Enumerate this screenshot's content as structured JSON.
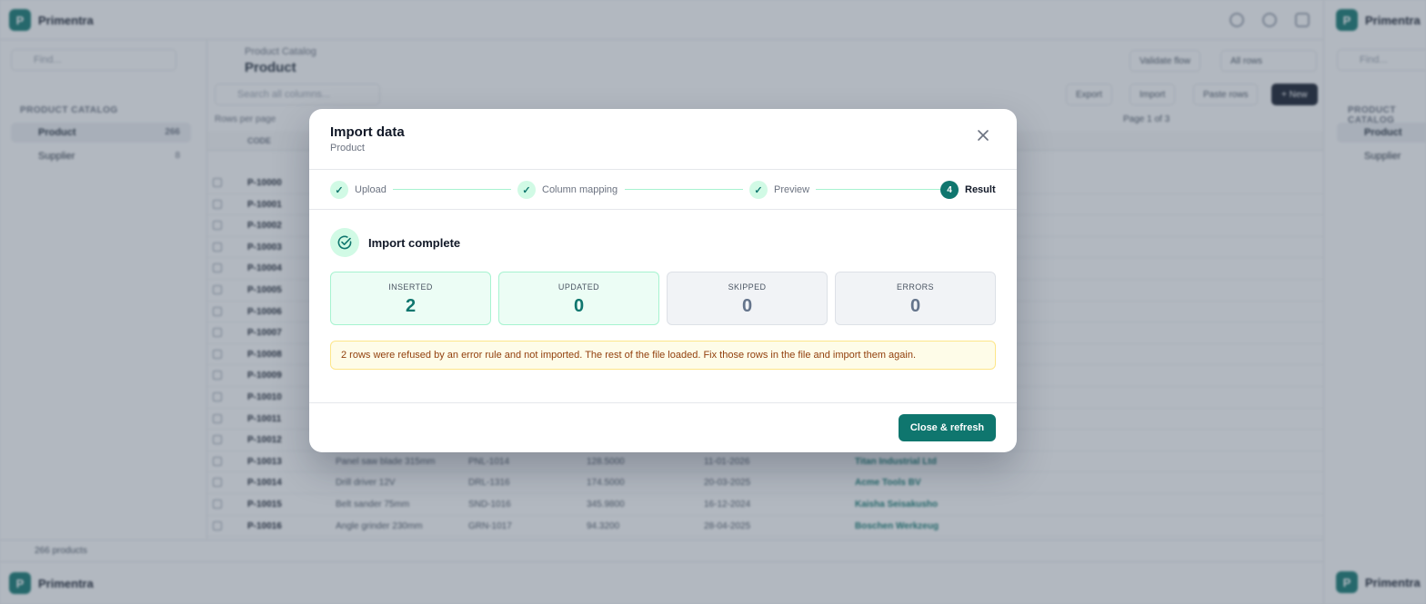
{
  "app": {
    "brand": "Primentra",
    "logo_letter": "P",
    "find_placeholder": "Find...",
    "sidebar": {
      "group": "PRODUCT CATALOG",
      "items": [
        {
          "label": "Product",
          "count": "266"
        },
        {
          "label": "Supplier",
          "count": "8"
        }
      ]
    },
    "header": {
      "breadcrumb": "Product Catalog",
      "title": "Product",
      "validate_label": "Validate flow",
      "view_label": "All rows"
    },
    "toolbar": {
      "search_placeholder": "Search all columns...",
      "export_label": "Export",
      "import_label": "Import",
      "paste_label": "Paste rows",
      "new_label": "+ New"
    },
    "grid": {
      "rows_per_page": "Rows per page",
      "page_info": "Page 1 of 3",
      "header_code": "CODE",
      "rows": [
        {
          "code": "P-10000"
        },
        {
          "code": "P-10001"
        },
        {
          "code": "P-10002"
        },
        {
          "code": "P-10003"
        },
        {
          "code": "P-10004"
        },
        {
          "code": "P-10005"
        },
        {
          "code": "P-10006"
        },
        {
          "code": "P-10007"
        },
        {
          "code": "P-10008"
        },
        {
          "code": "P-10009"
        },
        {
          "code": "P-10010"
        },
        {
          "code": "P-10011"
        },
        {
          "code": "P-10012"
        },
        {
          "code": "P-10013",
          "name": "Panel saw blade 315mm",
          "sku": "PNL-1014",
          "price": "128.5000",
          "date": "11-01-2026",
          "supplier": "Titan Industrial Ltd"
        },
        {
          "code": "P-10014",
          "name": "Drill driver 12V",
          "sku": "DRL-1316",
          "price": "174.5000",
          "date": "20-03-2025",
          "supplier": "Acme Tools BV"
        },
        {
          "code": "P-10015",
          "name": "Belt sander 75mm",
          "sku": "SND-1016",
          "price": "345.9800",
          "date": "16-12-2024",
          "supplier": "Kaisha Seisakusho"
        },
        {
          "code": "P-10016",
          "name": "Angle grinder 230mm",
          "sku": "GRN-1017",
          "price": "94.3200",
          "date": "28-04-2025",
          "supplier": "Boschen Werkzeug"
        }
      ]
    },
    "footer": {
      "count": "266 products"
    }
  },
  "modal": {
    "title": "Import data",
    "subtitle": "Product",
    "close_icon": "close-icon",
    "steps": [
      {
        "label": "Upload",
        "done": true
      },
      {
        "label": "Column mapping",
        "done": true
      },
      {
        "label": "Preview",
        "done": true
      },
      {
        "label": "Result",
        "number": "4",
        "current": true
      }
    ],
    "result_title": "Import complete",
    "stats": [
      {
        "label": "INSERTED",
        "value": "2"
      },
      {
        "label": "UPDATED",
        "value": "0"
      },
      {
        "label": "SKIPPED",
        "value": "0"
      },
      {
        "label": "ERRORS",
        "value": "0"
      }
    ],
    "warning": "2 rows were refused by an error rule and not imported. The rest of the file loaded. Fix those rows in the file and import them again.",
    "close_refresh_label": "Close & refresh"
  },
  "colors": {
    "accent": "#0f766e",
    "success_bg": "#ecfdf5",
    "warning_bg": "#fefce8",
    "warning_text": "#92400e"
  }
}
